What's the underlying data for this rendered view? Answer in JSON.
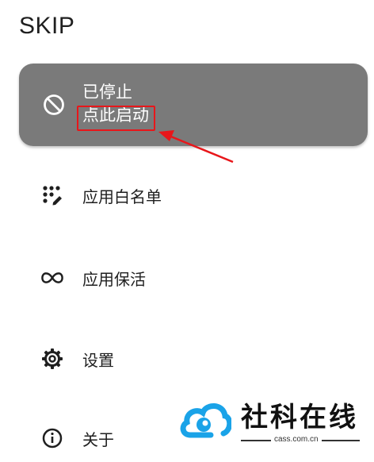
{
  "app": {
    "title": "SKIP"
  },
  "status_card": {
    "state_text": "已停止",
    "action_text": "点此启动",
    "icon": "block-icon",
    "background": "#7a7a7a"
  },
  "menu": {
    "items": [
      {
        "label": "应用白名单",
        "icon": "dots-edit-icon"
      },
      {
        "label": "应用保活",
        "icon": "infinity-icon"
      },
      {
        "label": "设置",
        "icon": "gear-icon"
      },
      {
        "label": "关于",
        "icon": "info-icon"
      }
    ]
  },
  "annotation": {
    "color": "#e8161a"
  },
  "watermark": {
    "name": "社科在线",
    "site": "cass.com.cn",
    "accent": "#1aa3e8"
  }
}
